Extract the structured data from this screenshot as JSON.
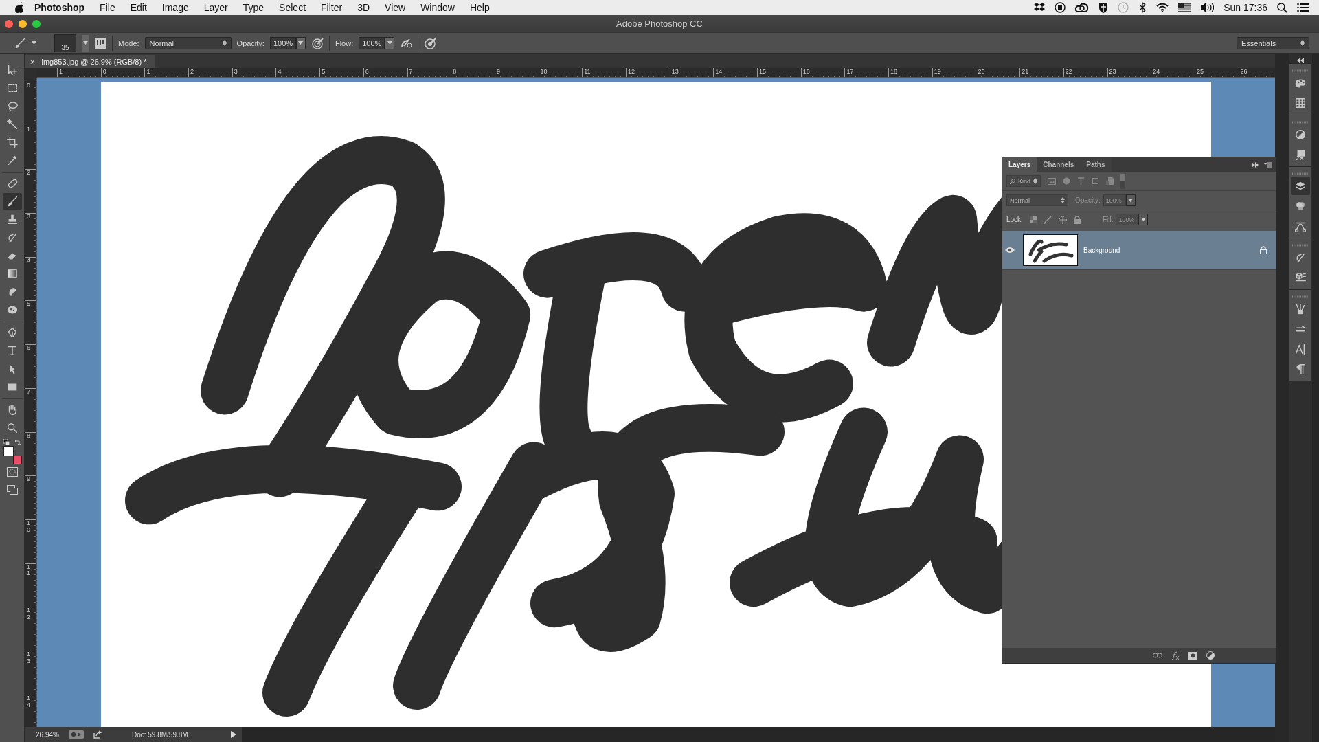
{
  "menu_bar": {
    "app": "Photoshop",
    "items": [
      "File",
      "Edit",
      "Image",
      "Layer",
      "Type",
      "Select",
      "Filter",
      "3D",
      "View",
      "Window",
      "Help"
    ],
    "clock": "Sun 17:36"
  },
  "window": {
    "title": "Adobe Photoshop CC"
  },
  "options_bar": {
    "brush_size": "35",
    "mode_label": "Mode:",
    "mode": "Normal",
    "opacity_label": "Opacity:",
    "opacity": "100%",
    "flow_label": "Flow:",
    "flow": "100%",
    "workspace": "Essentials"
  },
  "document_tab": {
    "close": "×",
    "title": "img853.jpg @ 26.9% (RGB/8) *",
    "selected": true
  },
  "tools": [
    {
      "kind": "move",
      "selected": false
    },
    {
      "kind": "marquee",
      "selected": false
    },
    {
      "kind": "lasso",
      "selected": false
    },
    {
      "kind": "wand",
      "selected": false
    },
    {
      "kind": "crop",
      "selected": false
    },
    {
      "kind": "eyedropper",
      "selected": false
    },
    {
      "kind": "healing",
      "selected": false
    },
    {
      "kind": "brush",
      "selected": true
    },
    {
      "kind": "stamp",
      "selected": false
    },
    {
      "kind": "history",
      "selected": false
    },
    {
      "kind": "eraser",
      "selected": false
    },
    {
      "kind": "gradient",
      "selected": false
    },
    {
      "kind": "blur",
      "selected": false
    },
    {
      "kind": "dodge",
      "selected": false
    },
    {
      "kind": "pen",
      "selected": false
    },
    {
      "kind": "type",
      "selected": false
    },
    {
      "kind": "path-select",
      "selected": false
    },
    {
      "kind": "rectangle",
      "selected": false
    },
    {
      "kind": "hand",
      "selected": false
    },
    {
      "kind": "zoom",
      "selected": false
    }
  ],
  "color_swatches": [
    {
      "kind": "foreground",
      "color": "#ffffff"
    },
    {
      "kind": "background",
      "color": "#e8506a"
    }
  ],
  "rulers": {
    "horizontal": [
      "1",
      "0",
      "1",
      "2",
      "3",
      "4",
      "5",
      "6",
      "7",
      "8",
      "9",
      "10",
      "11",
      "12",
      "13",
      "14",
      "15",
      "16",
      "17",
      "18",
      "19",
      "20",
      "21",
      "22",
      "23",
      "24",
      "25",
      "26"
    ],
    "vertical": [
      "0",
      "1",
      "2",
      "3",
      "4",
      "5",
      "6",
      "7",
      "8",
      "9",
      "10",
      "11",
      "12",
      "13",
      "14"
    ]
  },
  "layers_panel": {
    "tabs": [
      {
        "label": "Layers",
        "selected": true
      },
      {
        "label": "Channels",
        "selected": false
      },
      {
        "label": "Paths",
        "selected": false
      }
    ],
    "filter": "Kind",
    "blend_mode": "Normal",
    "opacity_label": "Opacity:",
    "opacity": {
      "value": "100%",
      "disabled": true
    },
    "lock_label": "Lock:",
    "fill_label": "Fill:",
    "fill": {
      "value": "100%",
      "disabled": true
    },
    "layers": [
      {
        "name": "Background",
        "visible": true,
        "selected": true,
        "locked": true
      }
    ]
  },
  "dock": [
    {
      "items": [
        {
          "kind": "palette",
          "selected": false
        },
        {
          "kind": "swatches",
          "selected": false
        }
      ]
    },
    {
      "items": [
        {
          "kind": "adjustments",
          "selected": false
        },
        {
          "kind": "styles",
          "selected": false
        }
      ]
    },
    {
      "items": [
        {
          "kind": "layers",
          "selected": true
        },
        {
          "kind": "channels",
          "selected": false
        },
        {
          "kind": "paths",
          "selected": false
        }
      ]
    },
    {
      "items": [
        {
          "kind": "history",
          "selected": false
        },
        {
          "kind": "properties",
          "selected": false
        }
      ]
    },
    {
      "items": [
        {
          "kind": "brushes",
          "selected": false
        },
        {
          "kind": "brush-presets",
          "selected": false
        },
        {
          "kind": "character",
          "selected": false
        },
        {
          "kind": "paragraph",
          "selected": false
        }
      ]
    }
  ],
  "status_bar": {
    "zoom": "26.94%",
    "doc": "Doc: 59.8M/59.8M"
  }
}
